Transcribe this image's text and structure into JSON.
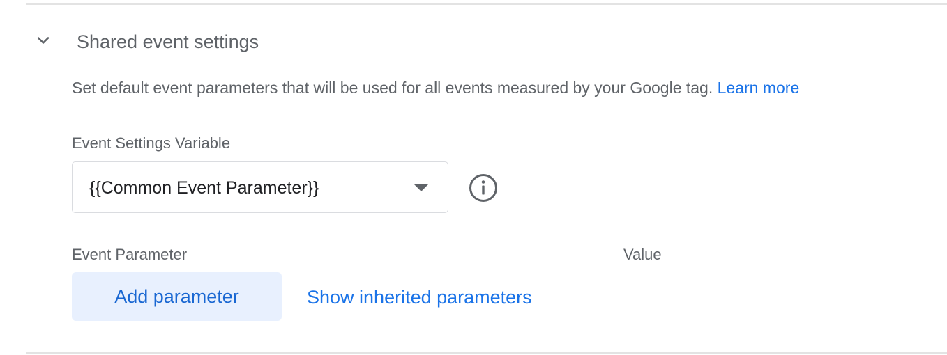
{
  "section": {
    "title": "Shared event settings",
    "expanded": true,
    "toggle_icon": "chevron-down-icon",
    "description": "Set default event parameters that will be used for all events measured by your Google tag.",
    "learn_more_label": "Learn more"
  },
  "event_settings": {
    "label": "Event Settings Variable",
    "selected_value": "{{Common Event Parameter}}",
    "dropdown_icon": "caret-down-icon",
    "info_icon": "info-icon"
  },
  "parameters": {
    "column_parameter": "Event Parameter",
    "column_value": "Value",
    "add_button_label": "Add parameter",
    "show_inherited_label": "Show inherited parameters"
  },
  "colors": {
    "link": "#1a73e8",
    "button_bg": "#e8f0fe",
    "button_text": "#1967d2",
    "secondary_text": "#5f6368",
    "border": "#dadce0"
  }
}
